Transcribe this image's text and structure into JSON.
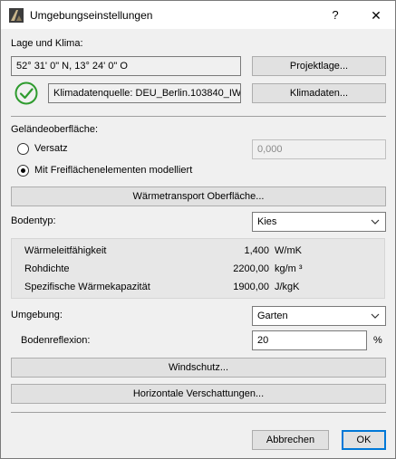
{
  "window": {
    "title": "Umgebungseinstellungen",
    "help_label": "?",
    "close_label": "✕"
  },
  "location": {
    "heading": "Lage und Klima:",
    "coords": "52° 31' 0\" N, 13° 24' 0\" O",
    "project_location_button": "Projektlage...",
    "climate_source": "Klimadatenquelle: DEU_Berlin.103840_IWEC",
    "climate_data_button": "Klimadaten..."
  },
  "terrain": {
    "heading": "Geländeoberfläche:",
    "option_offset": "Versatz",
    "offset_value": "0,000",
    "option_modeled": "Mit Freiflächenelementen modelliert",
    "selected": "modeled",
    "heat_transfer_button": "Wärmetransport Oberfläche..."
  },
  "soil": {
    "label": "Bodentyp:",
    "selected": "Kies",
    "properties": [
      {
        "name": "Wärmeleitfähigkeit",
        "value": "1,400",
        "unit": "W/mK"
      },
      {
        "name": "Rohdichte",
        "value": "2200,00",
        "unit": "kg/m ³"
      },
      {
        "name": "Spezifische Wärmekapazität",
        "value": "1900,00",
        "unit": "J/kgK"
      }
    ]
  },
  "environment": {
    "label": "Umgebung:",
    "selected": "Garten",
    "reflection_label": "Bodenreflexion:",
    "reflection_value": "20",
    "reflection_unit": "%",
    "wind_button": "Windschutz...",
    "shading_button": "Horizontale Verschattungen..."
  },
  "footer": {
    "cancel_button": "Abbrechen",
    "ok_button": "OK"
  },
  "colors": {
    "accent": "#0078d7",
    "check_green": "#2e9b2e"
  }
}
